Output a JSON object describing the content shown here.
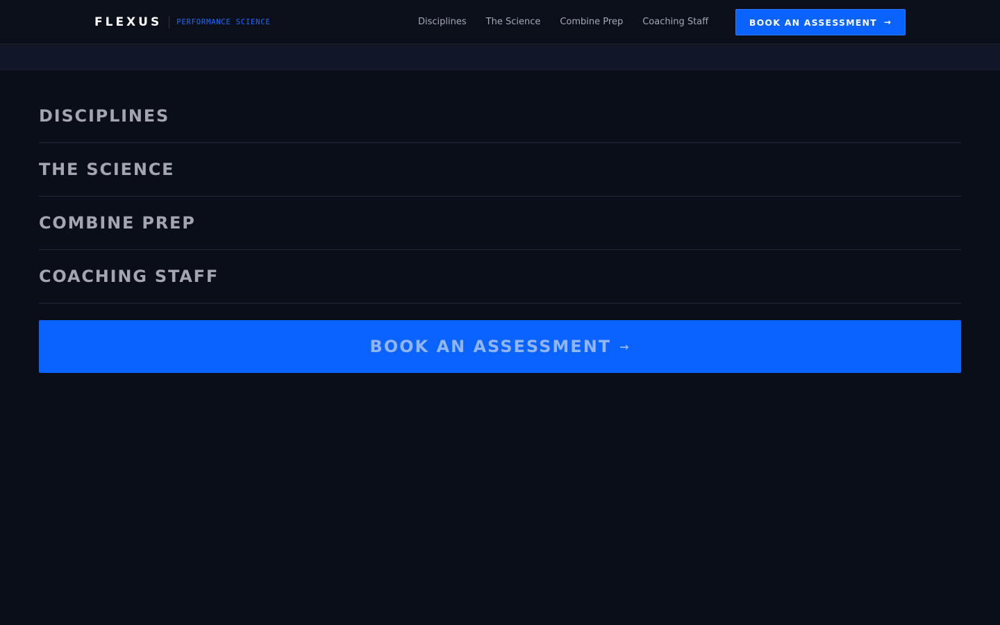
{
  "brand": {
    "name": "FLEXUS",
    "tagline": "PERFORMANCE SCIENCE"
  },
  "nav": {
    "links": [
      "Disciplines",
      "The Science",
      "Combine Prep",
      "Coaching Staff"
    ],
    "cta_label": "BOOK AN ASSESSMENT",
    "cta_arrow": "→"
  },
  "mobile_menu": {
    "items": [
      "DISCIPLINES",
      "THE SCIENCE",
      "COMBINE PREP",
      "COACHING STAFF"
    ],
    "cta_label": "BOOK AN ASSESSMENT",
    "cta_arrow": "→"
  },
  "colors": {
    "background": "#0a0e19",
    "accent": "#0a63ff",
    "brand_tag": "#1f6bff"
  }
}
